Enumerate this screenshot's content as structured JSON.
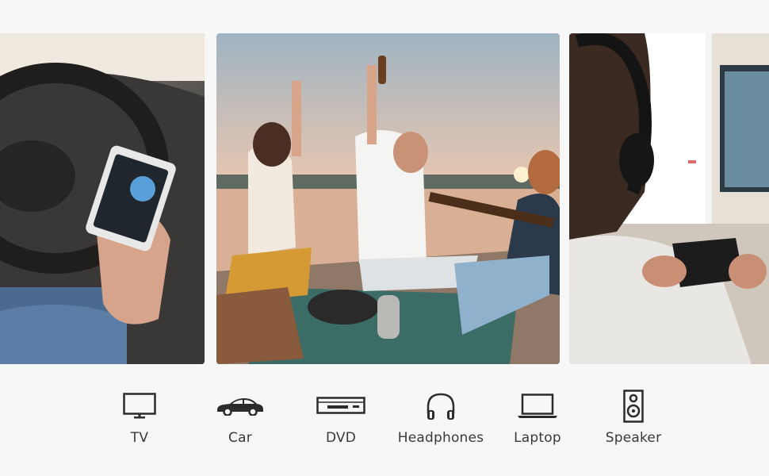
{
  "photos": {
    "car": "car-phone-photo",
    "beach": "beach-party-photo",
    "gaming": "gaming-headphones-photo"
  },
  "devices": [
    {
      "label": "TV",
      "icon": "tv-icon"
    },
    {
      "label": "Car",
      "icon": "car-icon"
    },
    {
      "label": "DVD",
      "icon": "dvd-player-icon"
    },
    {
      "label": "Headphones",
      "icon": "headphones-icon"
    },
    {
      "label": "Laptop",
      "icon": "laptop-icon"
    },
    {
      "label": "Speaker",
      "icon": "speaker-icon"
    }
  ],
  "colors": {
    "background": "#f7f7f7",
    "icon": "#2b2b2b",
    "label": "#3a3a3a"
  }
}
